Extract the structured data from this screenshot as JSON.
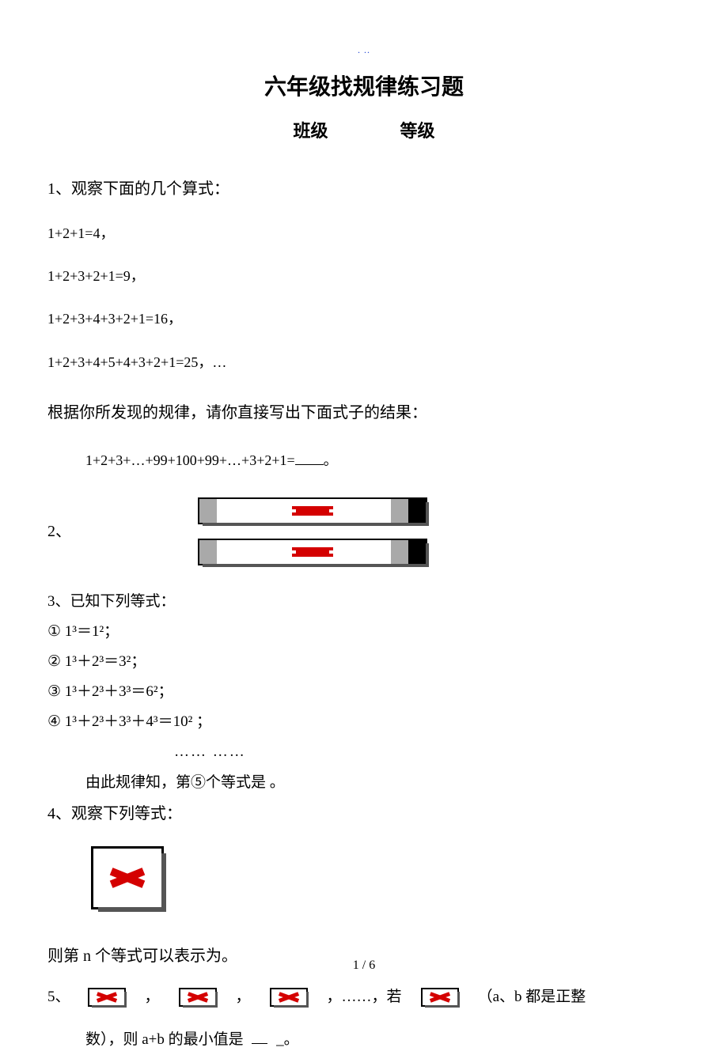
{
  "header_mark": ". ..",
  "title": "六年级找规律练习题",
  "subtitle_class_label": "班级",
  "subtitle_grade_label": "等级",
  "q1": {
    "lead": "1、观察下面的几个算式：",
    "lines": [
      "1+2+1=4，",
      "1+2+3+2+1=9，",
      "1+2+3+4+3+2+1=16，",
      "1+2+3+4+5+4+3+2+1=25，…"
    ],
    "find": "根据你所发现的规律，请你直接写出下面式子的结果：",
    "final_prefix": "1+2+3+…+99+100+99+…+3+2+1=",
    "final_suffix": "。"
  },
  "q2": {
    "label": "2、"
  },
  "q3": {
    "lead": "3、已知下列等式：",
    "items": [
      "① 1³＝1²；",
      "② 1³＋2³＝3²；",
      "③ 1³＋2³＋3³＝6²；",
      "④ 1³＋2³＋3³＋4³＝10² ；"
    ],
    "dots": "…… ……",
    "conclusion": "由此规律知，第⑤个等式是 。"
  },
  "q4": {
    "lead": "4、观察下列等式：",
    "conclusion": "则第 n 个等式可以表示为。"
  },
  "q5": {
    "label": "5、",
    "sep": "，",
    "tail1": "，……，若",
    "tail2": "（a、b 都是正整",
    "line2_a": "数），则 a+b 的最小值是",
    "line2_b": "_。"
  },
  "footer": "1 / 6"
}
